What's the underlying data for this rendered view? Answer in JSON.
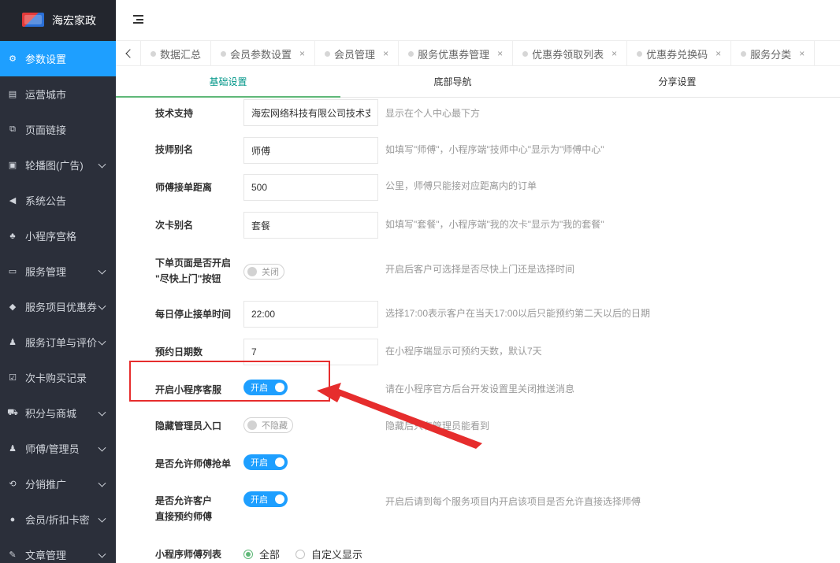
{
  "app": {
    "title": "海宏家政"
  },
  "sidebar": {
    "items": [
      {
        "label": "参数设置",
        "icon": "gear-icon",
        "glyph": "⚙",
        "active": true,
        "has_children": false
      },
      {
        "label": "运营城市",
        "icon": "building-icon",
        "glyph": "▤",
        "has_children": false
      },
      {
        "label": "页面链接",
        "icon": "link-icon",
        "glyph": "⧉",
        "has_children": false
      },
      {
        "label": "轮播图(广告)",
        "icon": "image-icon",
        "glyph": "▣",
        "has_children": true
      },
      {
        "label": "系统公告",
        "icon": "speaker-icon",
        "glyph": "◀",
        "has_children": false
      },
      {
        "label": "小程序宫格",
        "icon": "sitemap-icon",
        "glyph": "♣",
        "has_children": false
      },
      {
        "label": "服务管理",
        "icon": "list-icon",
        "glyph": "▭",
        "has_children": true
      },
      {
        "label": "服务项目优惠券",
        "icon": "tag-icon",
        "glyph": "◆",
        "has_children": true
      },
      {
        "label": "服务订单与评价",
        "icon": "user-icon",
        "glyph": "♟",
        "has_children": true
      },
      {
        "label": "次卡购买记录",
        "icon": "check-icon",
        "glyph": "☑",
        "has_children": false
      },
      {
        "label": "积分与商城",
        "icon": "cart-icon",
        "glyph": "⛟",
        "has_children": true
      },
      {
        "label": "师傅/管理员",
        "icon": "worker-icon",
        "glyph": "♟",
        "has_children": true
      },
      {
        "label": "分销推广",
        "icon": "share-icon",
        "glyph": "⟲",
        "has_children": true
      },
      {
        "label": "会员/折扣卡密",
        "icon": "member-icon",
        "glyph": "●",
        "has_children": true
      },
      {
        "label": "文章管理",
        "icon": "edit-icon",
        "glyph": "✎",
        "has_children": true
      }
    ]
  },
  "tabs": [
    {
      "label": "数据汇总",
      "closable": false
    },
    {
      "label": "会员参数设置",
      "closable": true
    },
    {
      "label": "会员管理",
      "closable": true
    },
    {
      "label": "服务优惠券管理",
      "closable": true
    },
    {
      "label": "优惠券领取列表",
      "closable": true
    },
    {
      "label": "优惠券兑换码",
      "closable": true
    },
    {
      "label": "服务分类",
      "closable": true
    }
  ],
  "subtabs": [
    {
      "label": "基础设置",
      "active": true
    },
    {
      "label": "底部导航",
      "active": false
    },
    {
      "label": "分享设置",
      "active": false
    }
  ],
  "form": {
    "tech_support": {
      "label": "技术支持",
      "value": "海宏网络科技有限公司技术支持",
      "hint": "显示在个人中心最下方"
    },
    "worker_alias": {
      "label": "技师别名",
      "value": "师傅",
      "hint": "如填写\"师傅\"，小程序端\"技师中心\"显示为\"师傅中心\""
    },
    "order_distance": {
      "label": "师傅接单距离",
      "value": "500",
      "hint": "公里，师傅只能接对应距离内的订单"
    },
    "card_alias": {
      "label": "次卡别名",
      "value": "套餐",
      "hint": "如填写\"套餐\"，小程序端\"我的次卡\"显示为\"我的套餐\""
    },
    "asap_button": {
      "label_line1": "下单页面是否开启",
      "label_line2": "\"尽快上门\"按钮",
      "switch_text": "关闭",
      "on": false,
      "hint": "开启后客户可选择是否尽快上门还是选择时间"
    },
    "stop_time": {
      "label": "每日停止接单时间",
      "value": "22:00",
      "hint": "选择17:00表示客户在当天17:00以后只能预约第二天以后的日期"
    },
    "booking_days": {
      "label": "预约日期数",
      "value": "7",
      "hint": "在小程序端显示可预约天数，默认7天"
    },
    "mp_service": {
      "label": "开启小程序客服",
      "switch_text": "开启",
      "on": true,
      "hint": "请在小程序官方后台开发设置里关闭推送消息"
    },
    "hide_admin": {
      "label": "隐藏管理员入口",
      "switch_text": "不隐藏",
      "on": false,
      "hint": "隐藏后只有管理员能看到"
    },
    "grab_order": {
      "label": "是否允许师傅抢单",
      "switch_text": "开启",
      "on": true
    },
    "direct_book": {
      "label_line1": "是否允许客户",
      "label_line2": "直接预约师傅",
      "switch_text": "开启",
      "on": true,
      "hint": "开启后请到每个服务项目内开启该项目是否允许直接选择师傅"
    },
    "worker_list": {
      "label": "小程序师傅列表",
      "options": [
        "全部",
        "自定义显示"
      ],
      "selected": "全部"
    }
  },
  "colors": {
    "sidebar_bg": "#2b2f3a",
    "accent": "#1e9fff",
    "tab_active": "#009688",
    "annotation": "#e62d2d"
  }
}
